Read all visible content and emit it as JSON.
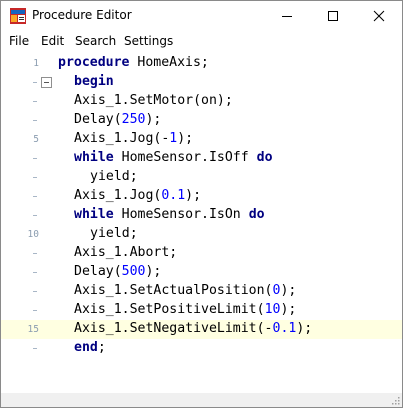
{
  "window": {
    "title": "Procedure Editor"
  },
  "menu": [
    "File",
    "Edit",
    "Search",
    "Settings"
  ],
  "editor": {
    "current_line": 15,
    "lines": [
      {
        "num": "1",
        "indent": 0,
        "tokens": [
          [
            "kw",
            "procedure"
          ],
          [
            "t",
            " HomeAxis;"
          ]
        ]
      },
      {
        "num": "",
        "indent": 1,
        "fold": true,
        "tokens": [
          [
            "kw",
            "begin"
          ]
        ]
      },
      {
        "num": "",
        "indent": 1,
        "tokens": [
          [
            "t",
            "Axis_1.SetMotor(on);"
          ]
        ]
      },
      {
        "num": "",
        "indent": 1,
        "tokens": [
          [
            "t",
            "Delay("
          ],
          [
            "num",
            "250"
          ],
          [
            "t",
            ");"
          ]
        ]
      },
      {
        "num": "5",
        "indent": 1,
        "tokens": [
          [
            "t",
            "Axis_1.Jog(-"
          ],
          [
            "num",
            "1"
          ],
          [
            "t",
            ");"
          ]
        ]
      },
      {
        "num": "",
        "indent": 1,
        "tokens": [
          [
            "kw",
            "while"
          ],
          [
            "t",
            " HomeSensor.IsOff "
          ],
          [
            "kw",
            "do"
          ]
        ]
      },
      {
        "num": "",
        "indent": 2,
        "tokens": [
          [
            "t",
            "yield;"
          ]
        ]
      },
      {
        "num": "",
        "indent": 1,
        "tokens": [
          [
            "t",
            "Axis_1.Jog("
          ],
          [
            "num",
            "0.1"
          ],
          [
            "t",
            ");"
          ]
        ]
      },
      {
        "num": "",
        "indent": 1,
        "tokens": [
          [
            "kw",
            "while"
          ],
          [
            "t",
            " HomeSensor.IsOn "
          ],
          [
            "kw",
            "do"
          ]
        ]
      },
      {
        "num": "10",
        "indent": 2,
        "tokens": [
          [
            "t",
            "yield;"
          ]
        ]
      },
      {
        "num": "",
        "indent": 1,
        "tokens": [
          [
            "t",
            "Axis_1.Abort;"
          ]
        ]
      },
      {
        "num": "",
        "indent": 1,
        "tokens": [
          [
            "t",
            "Delay("
          ],
          [
            "num",
            "500"
          ],
          [
            "t",
            ");"
          ]
        ]
      },
      {
        "num": "",
        "indent": 1,
        "tokens": [
          [
            "t",
            "Axis_1.SetActualPosition("
          ],
          [
            "num",
            "0"
          ],
          [
            "t",
            ");"
          ]
        ]
      },
      {
        "num": "",
        "indent": 1,
        "tokens": [
          [
            "t",
            "Axis_1.SetPositiveLimit("
          ],
          [
            "num",
            "10"
          ],
          [
            "t",
            ");"
          ]
        ]
      },
      {
        "num": "15",
        "indent": 1,
        "tokens": [
          [
            "t",
            "Axis_1.SetNegativeLimit(-"
          ],
          [
            "num",
            "0.1"
          ],
          [
            "t",
            ");"
          ]
        ]
      },
      {
        "num": "",
        "indent": 1,
        "tokens": [
          [
            "kw",
            "end"
          ],
          [
            "t",
            ";"
          ]
        ]
      }
    ]
  },
  "icons": {
    "app": "app-icon",
    "minimize": "minimize-icon",
    "maximize": "maximize-icon",
    "close": "close-icon",
    "fold": "fold-collapse-icon",
    "grip": "resize-grip-icon"
  },
  "colors": {
    "keyword": "#000080",
    "number": "#0000ff",
    "current_line": "#ffffe1",
    "line_number": "#8b9db0"
  }
}
